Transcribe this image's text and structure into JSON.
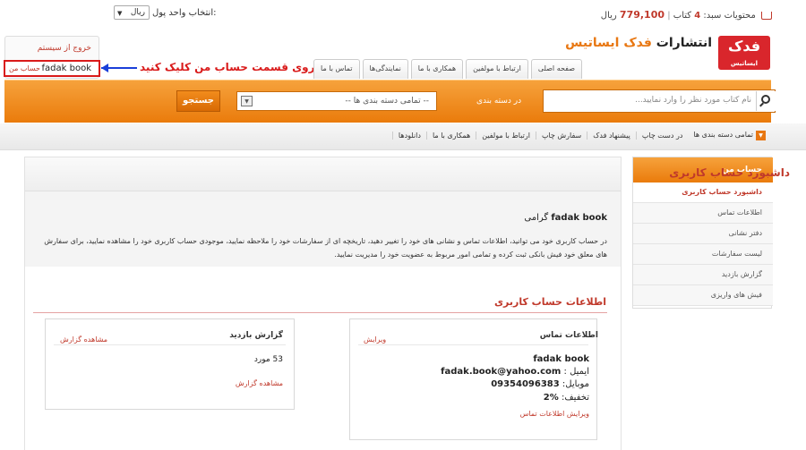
{
  "topbar": {
    "cart_label": "محتویات سبد:",
    "cart_count": "4",
    "cart_unit": "کتاب",
    "cart_price": "779,100",
    "cart_currency": "ریال",
    "currency_label": "انتخاب واحد پول:",
    "currency_selected": "ریال"
  },
  "header": {
    "logo_text_main": "انتشارات",
    "logo_text_brand": "فدک ایساتیس",
    "logo_mark": "فدک",
    "logo_mark_sub": "ایساتیس",
    "logout_label": "خروج از سیستم",
    "user_name": "fadak book",
    "account_link": "حساب من",
    "instruction": "بر روی قسمت حساب من کلیک کنید",
    "tabs": [
      "صفحه اصلی",
      "ارتباط با مولفین",
      "همکاری با ما",
      "نمایندگی‌ها",
      "تماس با ما"
    ]
  },
  "search": {
    "placeholder": "نام کتاب مورد نظر را وارد نمایید...",
    "category_label": "در دسته بندی",
    "category_selected": "-- تمامی دسته بندی ها --",
    "button_label": "جستجو"
  },
  "menu": {
    "items": [
      "تمامی دسته بندی ها",
      "در دست چاپ",
      "پیشنهاد فدک",
      "سفارش چاپ",
      "ارتباط با مولفین",
      "همکاری با ما",
      "دانلودها"
    ]
  },
  "sidebar": {
    "heading": "حساب من",
    "items": [
      "داشبورد حساب کاربری",
      "اطلاعات تماس",
      "دفتر نشانی",
      "لیست سفارشات",
      "گزارش بازدید",
      "فیش های واریزی"
    ]
  },
  "main": {
    "title": "داشبورد حساب کاربری",
    "greeting_name": "fadak book",
    "greeting_suffix": "گرامی",
    "description": "در حساب کاربری خود می توانید، اطلاعات تماس و نشانی های خود را تغییر دهید، تاریخچه ای از سفارشات خود را ملاحظه نمایید، موجودی حساب کاربری خود را مشاهده نمایید، برای سفارش های معلق خود فیش بانکی ثبت کرده و تمامی امور مربوط به عضویت خود را مدیریت نمایید.",
    "section_title": "اطلاعات حساب کاربری",
    "contact": {
      "heading": "اطلاعات تماس",
      "edit_link": "ویرایش",
      "name": "fadak book",
      "email_label": "ایمیل :",
      "email": "fadak.book@yahoo.com",
      "mobile_label": "موبایل:",
      "mobile": "09354096383",
      "discount_label": "تخفیف:",
      "discount": "%2",
      "edit_contact_link": "ویرایش اطلاعات تماس"
    },
    "visits": {
      "heading": "گزارش بازدید",
      "view_link": "مشاهده گزارش",
      "count": "53 مورد",
      "view_link_bottom": "مشاهده گزارش"
    }
  }
}
